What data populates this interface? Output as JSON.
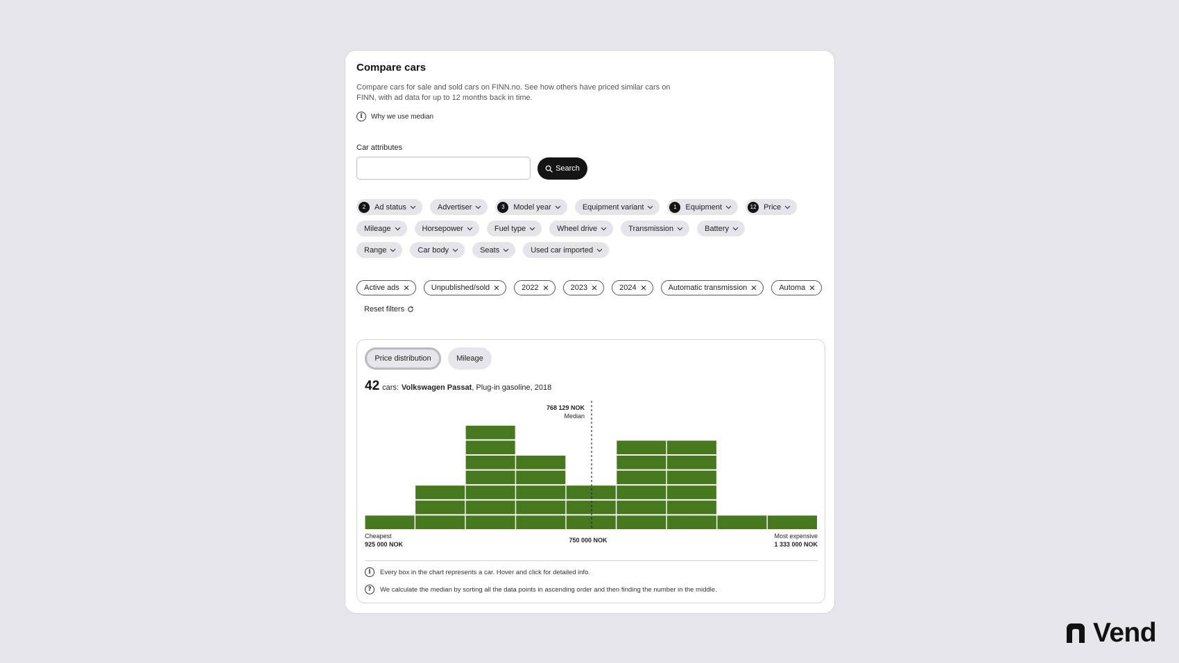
{
  "card": {
    "title": "Compare cars",
    "description": "Compare cars for sale and sold cars on FINN.no. See how others have priced similar cars on FINN, with ad data for up to 12 months back in time.",
    "why_link": "Why we use median"
  },
  "search": {
    "label": "Car attributes",
    "value": "",
    "button": "Search"
  },
  "filters": {
    "row1": [
      {
        "label": "Ad status",
        "count": "2"
      },
      {
        "label": "Advertiser",
        "count": ""
      },
      {
        "label": "Model year",
        "count": "3"
      },
      {
        "label": "Equipment variant",
        "count": ""
      },
      {
        "label": "Equipment",
        "count": "1"
      },
      {
        "label": "Price",
        "count": "12"
      }
    ],
    "row2": [
      {
        "label": "Mileage",
        "count": ""
      },
      {
        "label": "Horsepower",
        "count": ""
      },
      {
        "label": "Fuel type",
        "count": ""
      },
      {
        "label": "Wheel drive",
        "count": ""
      },
      {
        "label": "Transmission",
        "count": ""
      },
      {
        "label": "Battery",
        "count": ""
      }
    ],
    "row3": [
      {
        "label": "Range",
        "count": ""
      },
      {
        "label": "Car body",
        "count": ""
      },
      {
        "label": "Seats",
        "count": ""
      },
      {
        "label": "Used car imported",
        "count": ""
      }
    ]
  },
  "selected_filters": [
    "Active ads",
    "Unpublished/sold",
    "2022",
    "2023",
    "2024",
    "Automatic transmission",
    "Automa"
  ],
  "reset_label": "Reset filters",
  "tabs": {
    "price_distribution": "Price distribution",
    "mileage": "Mileage"
  },
  "summary": {
    "count": "42",
    "cars_label": "cars:",
    "model": "Volkswagen Passat",
    "details": ", Plug-in gasoline, 2018"
  },
  "chart_data": {
    "type": "bar",
    "description_unit": "cars per price bin",
    "values": [
      1,
      3,
      7,
      5,
      3,
      6,
      6,
      1,
      1
    ],
    "median_value": "768 129 NOK",
    "median_label": "Median",
    "left_label": "Cheapest",
    "left_value": "925 000 NOK",
    "center_value": "750 000 NOK",
    "right_label": "Most expensive",
    "right_value": "1 333 000 NOK",
    "bar_color": "#46791e"
  },
  "notes": {
    "note1": "Every box in the chart represents a car. Hover and click for detailed info.",
    "note2": "We calculate the median by sorting all the data points in ascending order and then finding the number in the middle."
  },
  "brand": {
    "name": "Vend"
  }
}
